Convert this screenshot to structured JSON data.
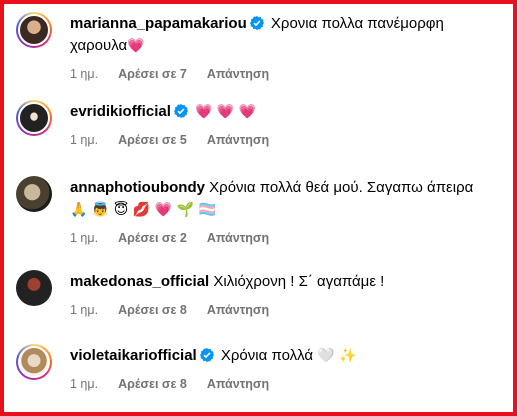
{
  "comments": [
    {
      "username": "marianna_papamakariou",
      "verified": true,
      "text": "Χρονια πολλα πανέμορφη χαρουλα",
      "emoji": "💗",
      "time": "1 ημ.",
      "likes": "Αρέσει σε 7",
      "reply": "Απάντηση"
    },
    {
      "username": "evridikiofficial",
      "verified": true,
      "text": "",
      "emoji": "💗 💗 💗",
      "time": "1 ημ.",
      "likes": "Αρέσει σε 5",
      "reply": "Απάντηση"
    },
    {
      "username": "annaphotioubondy",
      "verified": false,
      "text": "Χρόνια πολλά θεά μού. Σαγαπω άπειρα",
      "emoji": "🙏 👼 😇 💋 💗 🌱 🏳️‍⚧️",
      "time": "1 ημ.",
      "likes": "Αρέσει σε 2",
      "reply": "Απάντηση"
    },
    {
      "username": "makedonas_official",
      "verified": false,
      "text": "Χιλιόχρονη ! Σ΄ αγαπάμε !",
      "emoji": "",
      "time": "1 ημ.",
      "likes": "Αρέσει σε 8",
      "reply": "Απάντηση"
    },
    {
      "username": "violetaikariofficial",
      "verified": true,
      "text": "Χρόνια πολλά",
      "emoji": "🤍 ✨",
      "time": "1 ημ.",
      "likes": "Αρέσει σε 8",
      "reply": "Απάντηση"
    }
  ],
  "colors": {
    "border": "#e8101b",
    "verified": "#0095f6",
    "meta": "#737373",
    "heart": "#e8246b"
  }
}
